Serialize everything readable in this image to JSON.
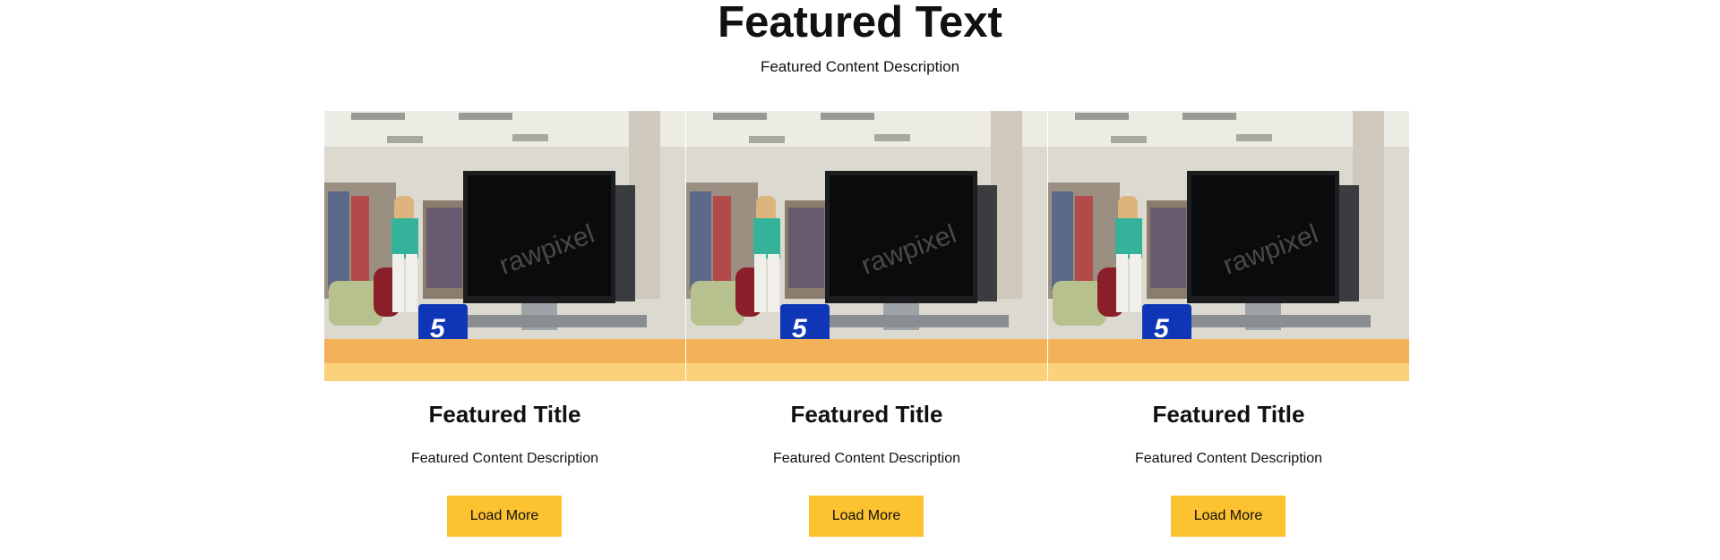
{
  "section": {
    "heading": "Featured Text",
    "description": "Featured Content Description"
  },
  "cards": [
    {
      "title": "Featured Title",
      "description": "Featured Content Description",
      "button_label": "Load More",
      "image_icon": "library-computer-photo",
      "sign_number": "5",
      "watermark": "rawpixel"
    },
    {
      "title": "Featured Title",
      "description": "Featured Content Description",
      "button_label": "Load More",
      "image_icon": "library-computer-photo",
      "sign_number": "5",
      "watermark": "rawpixel"
    },
    {
      "title": "Featured Title",
      "description": "Featured Content Description",
      "button_label": "Load More",
      "image_icon": "library-computer-photo",
      "sign_number": "5",
      "watermark": "rawpixel"
    }
  ],
  "colors": {
    "button": "#fdc22f",
    "text": "#111111",
    "background": "#ffffff"
  }
}
